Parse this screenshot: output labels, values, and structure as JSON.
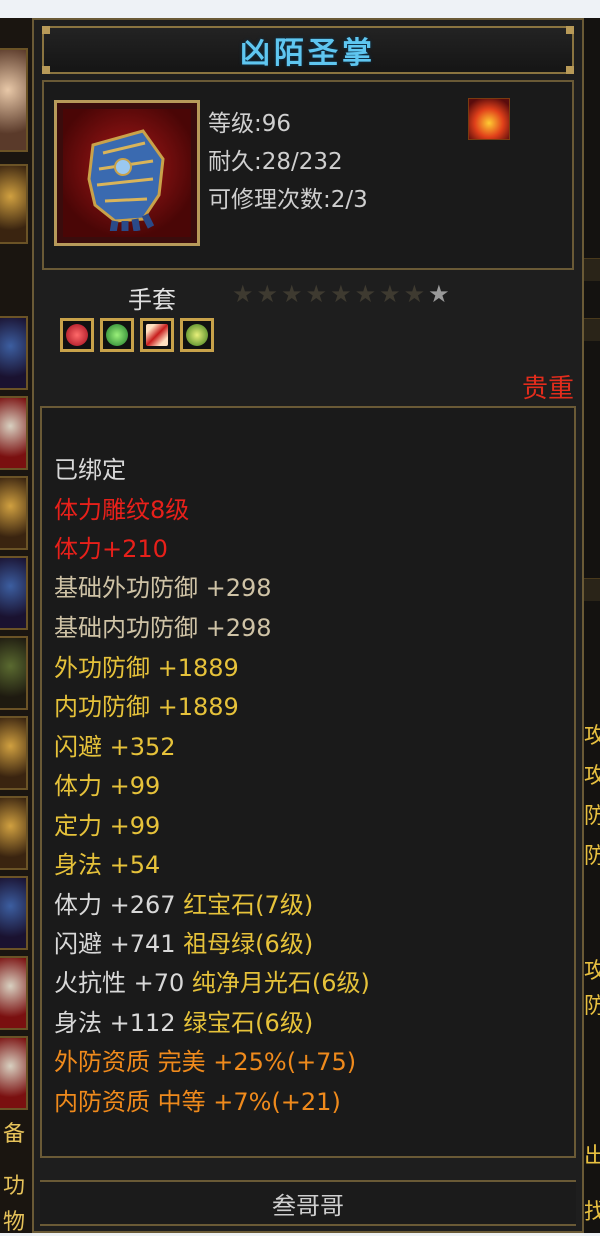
{
  "item": {
    "name": "凶陌圣掌",
    "level_line": "等级:96",
    "durability_line": "耐久:28/232",
    "repair_line": "可修理次数:2/3",
    "type": "手套",
    "stars_total": 9,
    "stars_filled": 8,
    "precious_tag": "贵重",
    "gems": [
      "red-gem-icon",
      "green-gem-icon",
      "sword-gem-icon",
      "green-orb-gem-icon"
    ],
    "owner": "叁哥哥"
  },
  "attributes": [
    {
      "text": "已绑定",
      "color": "white"
    },
    {
      "text": "体力雕纹8级",
      "color": "red"
    },
    {
      "text": "体力+210",
      "color": "red"
    },
    {
      "text": "基础外功防御 +298",
      "color": "tan"
    },
    {
      "text": "基础内功防御 +298",
      "color": "tan"
    },
    {
      "text": "外功防御 +1889",
      "color": "yellow"
    },
    {
      "text": "内功防御 +1889",
      "color": "yellow"
    },
    {
      "text": "闪避 +352",
      "color": "yellow"
    },
    {
      "text": "体力 +99",
      "color": "yellow"
    },
    {
      "text": "定力 +99",
      "color": "yellow"
    },
    {
      "text": "身法 +54",
      "color": "yellow"
    },
    {
      "text": "体力 +267 红宝石(7级)",
      "color": "white",
      "accent": "红宝石(7级)"
    },
    {
      "text": "闪避 +741 祖母绿(6级)",
      "color": "white",
      "accent": "祖母绿(6级)"
    },
    {
      "text": "火抗性 +70 纯净月光石(6级)",
      "color": "white",
      "accent": "纯净月光石(6级)"
    },
    {
      "text": "身法 +112 绿宝石(6级)",
      "color": "white",
      "accent": "绿宝石(6级)"
    },
    {
      "text": "外防资质  完美 +25%(+75)",
      "color": "orange"
    },
    {
      "text": "内防资质  中等 +7%(+21)",
      "color": "orange"
    }
  ],
  "side_left": {
    "labels": [
      "备",
      "功",
      "物"
    ]
  },
  "side_right": {
    "labels": [
      "攻",
      "攻",
      "防",
      "防",
      "攻",
      "防",
      "出",
      "找"
    ]
  },
  "colors": {
    "title": "#5fc6f0",
    "red": "#e8201a",
    "yellow": "#e6c23a",
    "orange": "#ef8a1c",
    "border": "#6a5a36"
  }
}
